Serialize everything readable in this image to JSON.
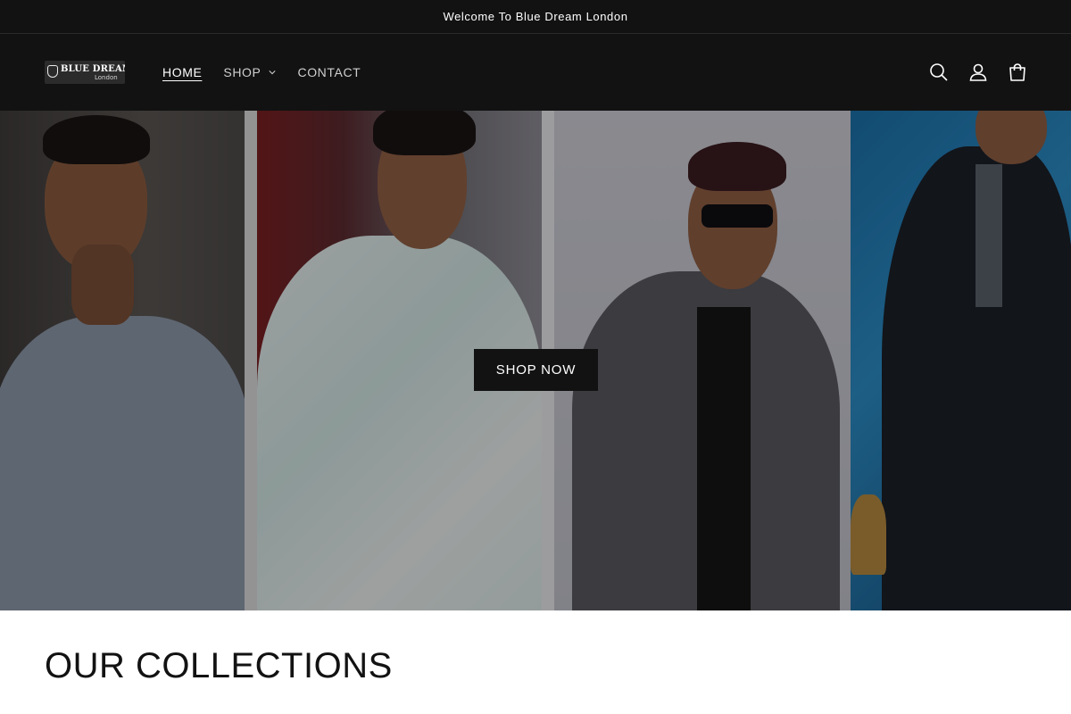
{
  "announcement": {
    "text": "Welcome To Blue Dream London"
  },
  "brand": {
    "logo_main": "BLUE DREAM",
    "logo_sub": "London"
  },
  "nav": {
    "items": [
      {
        "label": "HOME",
        "active": true
      },
      {
        "label": "SHOP",
        "has_dropdown": true
      },
      {
        "label": "CONTACT"
      }
    ]
  },
  "header_icons": [
    "search-icon",
    "account-icon",
    "cart-icon"
  ],
  "hero": {
    "cta_label": "SHOP NOW",
    "panels": [
      "polo-shirt-model",
      "floral-shirt-model",
      "jacket-model",
      "panjabi-model"
    ]
  },
  "collections": {
    "title": "OUR COLLECTIONS"
  },
  "colors": {
    "header_bg": "#121212",
    "text_light": "#ffffff",
    "button_bg": "#121212"
  }
}
